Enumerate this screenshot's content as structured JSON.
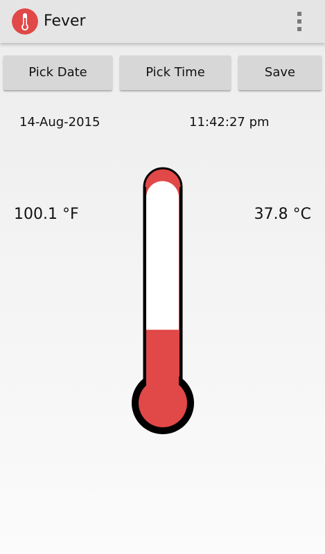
{
  "app": {
    "title": "Fever",
    "icon": "thermometer-icon",
    "overflow_icon": "overflow-menu-icon"
  },
  "toolbar": {
    "pick_date_label": "Pick Date",
    "pick_time_label": "Pick Time",
    "save_label": "Save"
  },
  "reading": {
    "date": "14-Aug-2015",
    "time": "11:42:27 pm",
    "fahrenheit": "100.1 °F",
    "celsius": "37.8 °C"
  },
  "thermometer": {
    "fill_fraction": 0.36
  },
  "colors": {
    "accent_red": "#e14848",
    "action_bar": "#e5e5e5",
    "button": "#d7d7d7",
    "outline": "#000000"
  }
}
